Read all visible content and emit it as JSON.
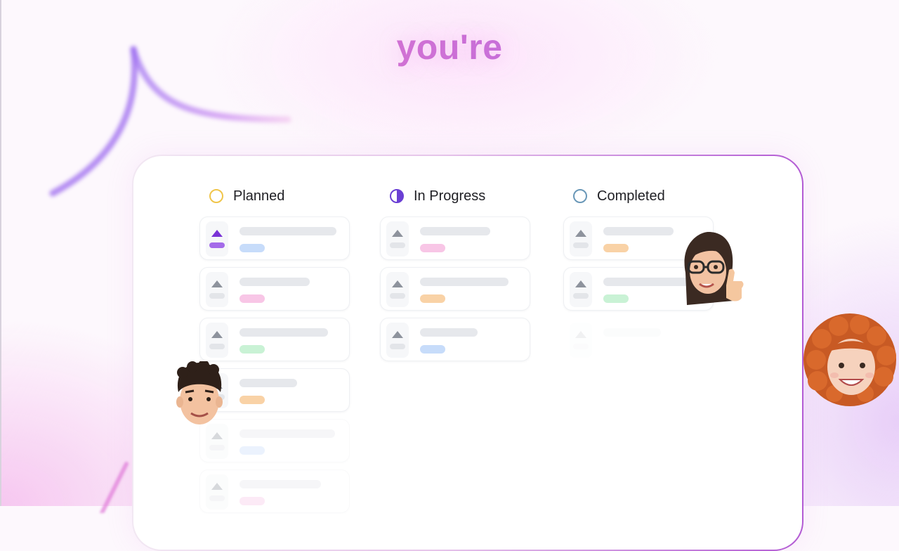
{
  "hero": {
    "headline": "you're"
  },
  "colors": {
    "planned": "#f0c54a",
    "in_progress": "#6a3fd4",
    "completed": "#6a98b8",
    "tag_blue": "#c7dcfa",
    "tag_pink": "#f8c6e6",
    "tag_green": "#c9f2d5",
    "tag_orange": "#f9d2a6"
  },
  "board": {
    "columns": [
      {
        "title": "Planned",
        "status_icon": "empty-circle-icon"
      },
      {
        "title": "In Progress",
        "status_icon": "half-circle-icon"
      },
      {
        "title": "Completed",
        "status_icon": "outline-circle-icon"
      }
    ]
  },
  "avatars": [
    {
      "name": "memoji-woman-thumbs-up"
    },
    {
      "name": "memoji-man-curly-hair"
    },
    {
      "name": "memoji-girl-curly-red-hair"
    }
  ]
}
